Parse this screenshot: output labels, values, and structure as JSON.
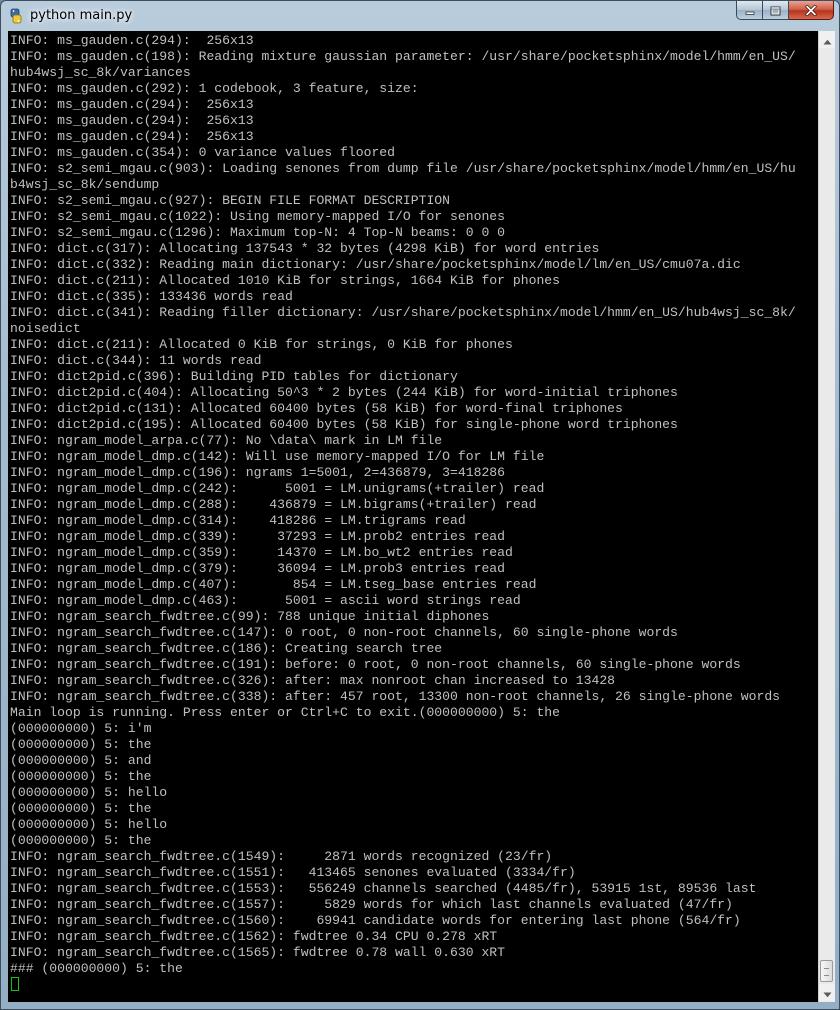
{
  "window": {
    "title": "python main.py"
  },
  "icons": {
    "app": "python-icon",
    "minimize": "minimize-icon",
    "maximize": "maximize-icon",
    "close": "close-icon",
    "scroll_up": "arrow-up-icon",
    "scroll_down": "arrow-down-icon"
  },
  "colors": {
    "console_bg": "#000000",
    "console_text": "#c0c0c0",
    "cursor": "#18c018",
    "close_button": "#c8442c"
  },
  "console": {
    "lines": [
      "INFO: ms_gauden.c(294):  256x13",
      "INFO: ms_gauden.c(198): Reading mixture gaussian parameter: /usr/share/pocketsphinx/model/hmm/en_US/",
      "hub4wsj_sc_8k/variances",
      "INFO: ms_gauden.c(292): 1 codebook, 3 feature, size:",
      "INFO: ms_gauden.c(294):  256x13",
      "INFO: ms_gauden.c(294):  256x13",
      "INFO: ms_gauden.c(294):  256x13",
      "INFO: ms_gauden.c(354): 0 variance values floored",
      "INFO: s2_semi_mgau.c(903): Loading senones from dump file /usr/share/pocketsphinx/model/hmm/en_US/hu",
      "b4wsj_sc_8k/sendump",
      "INFO: s2_semi_mgau.c(927): BEGIN FILE FORMAT DESCRIPTION",
      "INFO: s2_semi_mgau.c(1022): Using memory-mapped I/O for senones",
      "INFO: s2_semi_mgau.c(1296): Maximum top-N: 4 Top-N beams: 0 0 0",
      "INFO: dict.c(317): Allocating 137543 * 32 bytes (4298 KiB) for word entries",
      "INFO: dict.c(332): Reading main dictionary: /usr/share/pocketsphinx/model/lm/en_US/cmu07a.dic",
      "INFO: dict.c(211): Allocated 1010 KiB for strings, 1664 KiB for phones",
      "INFO: dict.c(335): 133436 words read",
      "INFO: dict.c(341): Reading filler dictionary: /usr/share/pocketsphinx/model/hmm/en_US/hub4wsj_sc_8k/",
      "noisedict",
      "INFO: dict.c(211): Allocated 0 KiB for strings, 0 KiB for phones",
      "INFO: dict.c(344): 11 words read",
      "INFO: dict2pid.c(396): Building PID tables for dictionary",
      "INFO: dict2pid.c(404): Allocating 50^3 * 2 bytes (244 KiB) for word-initial triphones",
      "INFO: dict2pid.c(131): Allocated 60400 bytes (58 KiB) for word-final triphones",
      "INFO: dict2pid.c(195): Allocated 60400 bytes (58 KiB) for single-phone word triphones",
      "INFO: ngram_model_arpa.c(77): No \\data\\ mark in LM file",
      "INFO: ngram_model_dmp.c(142): Will use memory-mapped I/O for LM file",
      "INFO: ngram_model_dmp.c(196): ngrams 1=5001, 2=436879, 3=418286",
      "INFO: ngram_model_dmp.c(242):      5001 = LM.unigrams(+trailer) read",
      "INFO: ngram_model_dmp.c(288):    436879 = LM.bigrams(+trailer) read",
      "INFO: ngram_model_dmp.c(314):    418286 = LM.trigrams read",
      "INFO: ngram_model_dmp.c(339):     37293 = LM.prob2 entries read",
      "INFO: ngram_model_dmp.c(359):     14370 = LM.bo_wt2 entries read",
      "INFO: ngram_model_dmp.c(379):     36094 = LM.prob3 entries read",
      "INFO: ngram_model_dmp.c(407):       854 = LM.tseg_base entries read",
      "INFO: ngram_model_dmp.c(463):      5001 = ascii word strings read",
      "INFO: ngram_search_fwdtree.c(99): 788 unique initial diphones",
      "INFO: ngram_search_fwdtree.c(147): 0 root, 0 non-root channels, 60 single-phone words",
      "INFO: ngram_search_fwdtree.c(186): Creating search tree",
      "INFO: ngram_search_fwdtree.c(191): before: 0 root, 0 non-root channels, 60 single-phone words",
      "INFO: ngram_search_fwdtree.c(326): after: max nonroot chan increased to 13428",
      "INFO: ngram_search_fwdtree.c(338): after: 457 root, 13300 non-root channels, 26 single-phone words",
      "Main loop is running. Press enter or Ctrl+C to exit.(000000000) 5: the",
      "(000000000) 5: i'm",
      "(000000000) 5: the",
      "(000000000) 5: and",
      "(000000000) 5: the",
      "(000000000) 5: hello",
      "(000000000) 5: the",
      "(000000000) 5: hello",
      "(000000000) 5: the",
      "INFO: ngram_search_fwdtree.c(1549):     2871 words recognized (23/fr)",
      "INFO: ngram_search_fwdtree.c(1551):   413465 senones evaluated (3334/fr)",
      "INFO: ngram_search_fwdtree.c(1553):   556249 channels searched (4485/fr), 53915 1st, 89536 last",
      "INFO: ngram_search_fwdtree.c(1557):     5829 words for which last channels evaluated (47/fr)",
      "INFO: ngram_search_fwdtree.c(1560):    69941 candidate words for entering last phone (564/fr)",
      "INFO: ngram_search_fwdtree.c(1562): fwdtree 0.34 CPU 0.278 xRT",
      "INFO: ngram_search_fwdtree.c(1565): fwdtree 0.78 wall 0.630 xRT",
      "### (000000000) 5: the"
    ]
  }
}
